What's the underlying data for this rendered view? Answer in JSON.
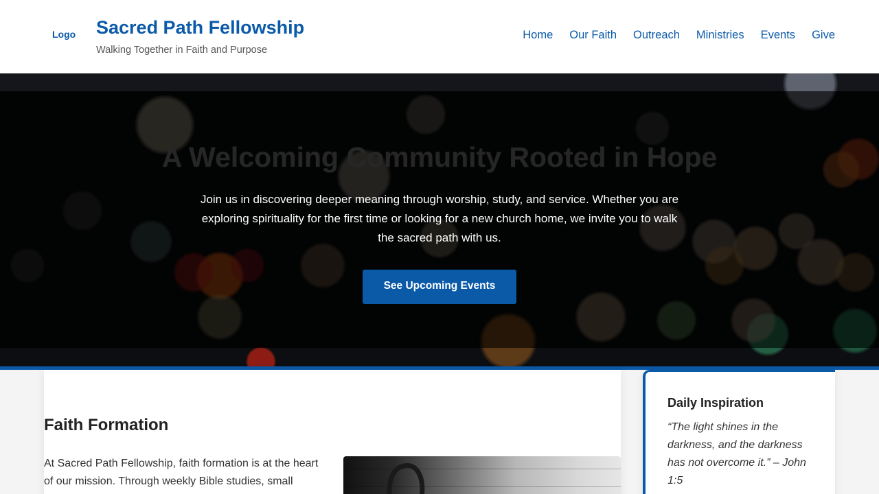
{
  "header": {
    "logo_label": "Logo",
    "site_title": "Sacred Path Fellowship",
    "tagline": "Walking Together in Faith and Purpose",
    "nav": [
      "Home",
      "Our Faith",
      "Outreach",
      "Ministries",
      "Events",
      "Give"
    ]
  },
  "hero": {
    "title": "A Welcoming Community Rooted in Hope",
    "text": "Join us in discovering deeper meaning through worship, study, and service. Whether you are exploring spirituality for the first time or looking for a new church home, we invite you to walk the sacred path with us.",
    "cta_label": "See Upcoming Events"
  },
  "main": {
    "section_title": "Faith Formation",
    "section_body": "At Sacred Path Fellowship, faith formation is at the heart of our mission. Through weekly Bible studies, small"
  },
  "sidebar": {
    "title": "Daily Inspiration",
    "quote": "“The light shines in the darkness, and the darkness has not overcome it.” – John 1:5"
  },
  "colors": {
    "brand_blue": "#0b5aa8",
    "hero_overlay": "#000000",
    "page_bg": "#f4f4f4"
  }
}
